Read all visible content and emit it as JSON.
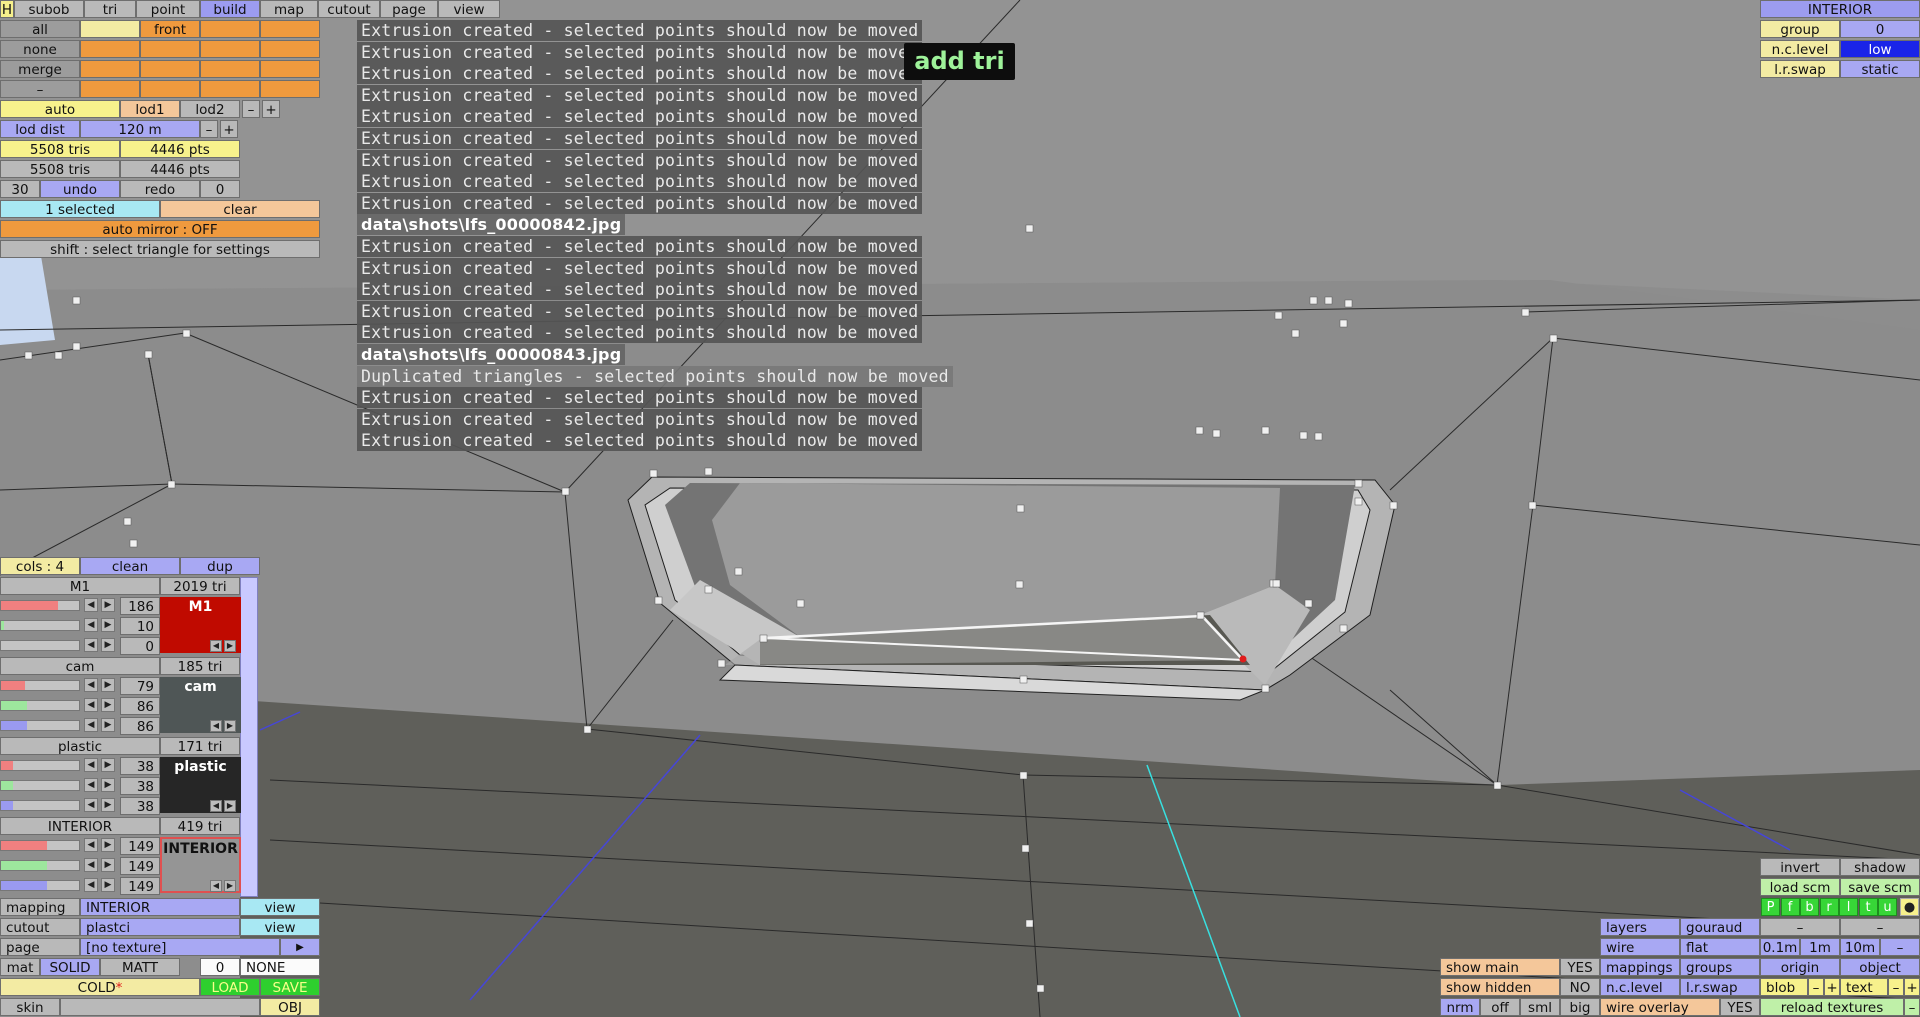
{
  "top_menu": {
    "h": "H",
    "subob": "subob",
    "tri": "tri",
    "point": "point",
    "build": "build",
    "map": "map",
    "cutout": "cutout",
    "page": "page",
    "view": "view"
  },
  "sel_panel": {
    "all": "all",
    "none": "none",
    "merge": "merge",
    "dash": "–",
    "front": "front"
  },
  "lod": {
    "auto": "auto",
    "lod1": "lod1",
    "lod2": "lod2",
    "minus": "–",
    "plus": "+",
    "dist_label": "lod dist",
    "dist_value": "120 m",
    "dist_minus": "–",
    "dist_plus": "+",
    "tris1": "5508 tris",
    "pts1": "4446 pts",
    "tris2": "5508 tris",
    "pts2": "4446 pts"
  },
  "history": {
    "count_left": "30",
    "undo": "undo",
    "redo": "redo",
    "count_right": "0"
  },
  "selection": {
    "selected": "1 selected",
    "clear": "clear",
    "auto_mirror": "auto mirror : OFF",
    "shift_hint": "shift : select triangle for settings"
  },
  "log": [
    "Extrusion created - selected points should now be moved",
    "Extrusion created - selected points should now be moved",
    "Extrusion created - selected points should now be moved",
    "Extrusion created - selected points should now be moved",
    "Extrusion created - selected points should now be moved",
    "Extrusion created - selected points should now be moved",
    "Extrusion created - selected points should now be moved",
    "Extrusion created - selected points should now be moved",
    "Extrusion created - selected points should now be moved",
    "data\\shots\\lfs_00000842.jpg",
    "Extrusion created - selected points should now be moved",
    "Extrusion created - selected points should now be moved",
    "Extrusion created - selected points should now be moved",
    "Extrusion created - selected points should now be moved",
    "Extrusion created - selected points should now be moved",
    "data\\shots\\lfs_00000843.jpg",
    "Duplicated triangles - selected points should now be moved",
    "Extrusion created - selected points should now be moved",
    "Extrusion created - selected points should now be moved",
    "Extrusion created - selected points should now be moved"
  ],
  "mode_label": "add tri",
  "interior_panel": {
    "title": "INTERIOR",
    "group_label": "group",
    "group_value": "0",
    "nclevel_label": "n.c.level",
    "nclevel_value": "low",
    "lrswap_label": "l.r.swap",
    "lrswap_value": "static"
  },
  "colours": {
    "cols": "cols : 4",
    "clean": "clean",
    "dup": "dup",
    "materials": [
      {
        "name": "M1",
        "tris": "2019 tri",
        "r": "186",
        "g": "10",
        "b": "0",
        "swatch_label": "M1",
        "color": "#c00a00",
        "text_color": "#ffffff"
      },
      {
        "name": "cam",
        "tris": "185 tri",
        "r": "79",
        "g": "86",
        "b": "86",
        "swatch_label": "cam",
        "color": "#4f5656",
        "text_color": "#ffffff"
      },
      {
        "name": "plastic",
        "tris": "171 tri",
        "r": "38",
        "g": "38",
        "b": "38",
        "swatch_label": "plastic",
        "color": "#262626",
        "text_color": "#ffffff"
      },
      {
        "name": "INTERIOR",
        "tris": "419 tri",
        "r": "149",
        "g": "149",
        "b": "149",
        "swatch_label": "INTERIOR",
        "color": "#959595",
        "text_color": "#111111"
      }
    ]
  },
  "bottom_left": {
    "mapping_label": "mapping",
    "mapping_value": "INTERIOR",
    "mapping_view": "view",
    "cutout_label": "cutout",
    "cutout_value": "plastci",
    "cutout_view": "view",
    "page_label": "page",
    "page_value": "[no texture]",
    "page_arrow": "▶",
    "mat_label": "mat",
    "solid": "SOLID",
    "matt": "MATT",
    "mat_num": "0",
    "none": "NONE",
    "cold": "COLD",
    "cold_star": "*",
    "load": "LOAD",
    "save": "SAVE",
    "skin": "skin",
    "obj": "OBJ"
  },
  "bottom_right": {
    "invert": "invert",
    "shadow": "shadow",
    "load_scm": "load scm",
    "save_scm": "save scm",
    "views": [
      "P",
      "f",
      "b",
      "r",
      "l",
      "t",
      "u"
    ],
    "dot": "●",
    "dash1": "–",
    "dash2": "–",
    "layers": "layers",
    "gouraud": "gouraud",
    "wire": "wire",
    "flat": "flat",
    "s01": "0.1m",
    "s1": "1m",
    "s10": "10m",
    "sdash": "–",
    "mappings": "mappings",
    "groups": "groups",
    "origin": "origin",
    "object": "object",
    "show_main": "show main",
    "show_main_v": "YES",
    "nclevel": "n.c.level",
    "lrswap": "l.r.swap",
    "blob": "blob",
    "blob_minus": "–",
    "blob_plus": "+",
    "text": "text",
    "text_minus": "–",
    "text_plus": "+",
    "show_hidden": "show hidden",
    "show_hidden_v": "NO",
    "nrm": "nrm",
    "off": "off",
    "sml": "sml",
    "big": "big",
    "wire_overlay": "wire overlay",
    "wire_overlay_v": "YES",
    "reload_textures": "reload textures",
    "reload_dash": "–"
  }
}
